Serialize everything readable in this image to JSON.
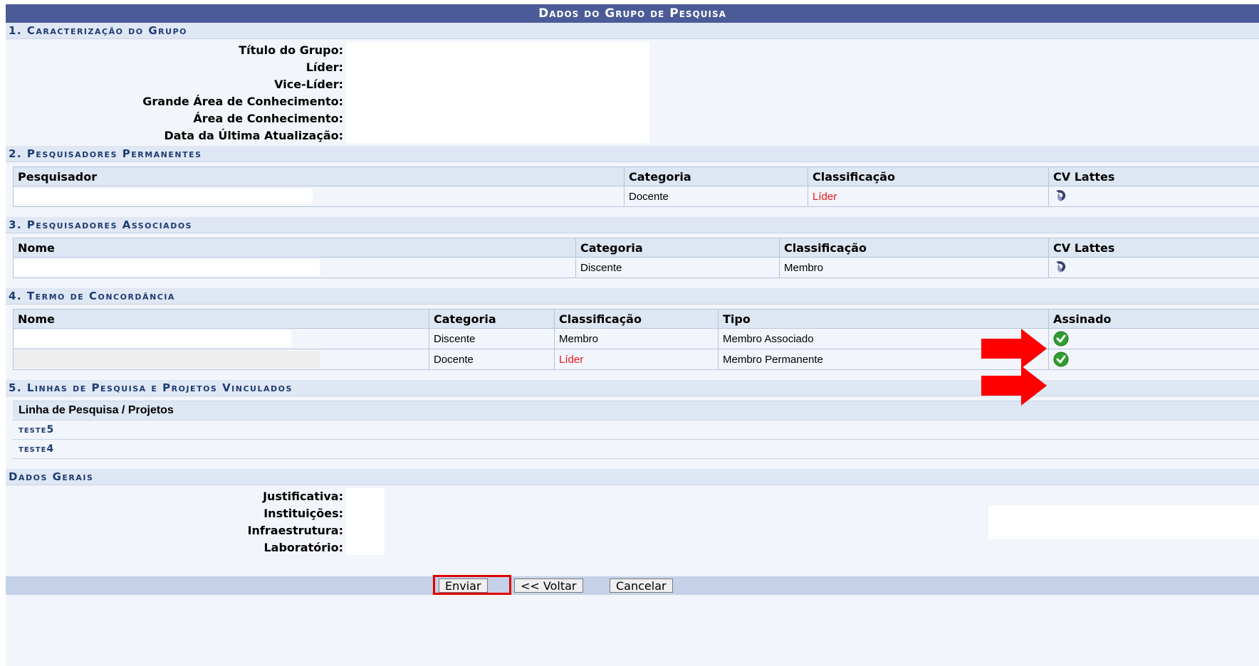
{
  "page_title": "Dados do Grupo de Pesquisa",
  "section1": {
    "title": "1. Caracterização do Grupo",
    "labels": [
      "Título do Grupo:",
      "Líder:",
      "Vice-Líder:",
      "Grande Área de Conhecimento:",
      "Área de Conhecimento:",
      "Data da Última Atualização:"
    ]
  },
  "section2": {
    "title": "2. Pesquisadores Permanentes",
    "headers": [
      "Pesquisador",
      "Categoria",
      "Classificação",
      "CV Lattes"
    ],
    "rows": [
      {
        "categoria": "Docente",
        "classificacao": "Líder"
      }
    ]
  },
  "section3": {
    "title": "3. Pesquisadores Associados",
    "headers": [
      "Nome",
      "Categoria",
      "Classificação",
      "CV Lattes"
    ],
    "rows": [
      {
        "categoria": "Discente",
        "classificacao": "Membro"
      }
    ]
  },
  "section4": {
    "title": "4. Termo de Concordância",
    "headers": [
      "Nome",
      "Categoria",
      "Classificação",
      "Tipo",
      "Assinado"
    ],
    "rows": [
      {
        "categoria": "Discente",
        "classificacao": "Membro",
        "tipo": "Membro Associado"
      },
      {
        "categoria": "Docente",
        "classificacao": "Líder",
        "tipo": "Membro Permanente"
      }
    ]
  },
  "section5": {
    "title": "5. Linhas de Pesquisa e Projetos Vinculados",
    "header": "Linha de Pesquisa / Projetos",
    "items": [
      "teste5",
      "teste4"
    ]
  },
  "dados_gerais": {
    "title": "Dados Gerais",
    "labels": [
      "Justificativa:",
      "Instituições:",
      "Infraestrutura:",
      "Laboratório:"
    ]
  },
  "buttons": {
    "enviar": "Enviar",
    "voltar": "<< Voltar",
    "cancelar": "Cancelar"
  },
  "colors": {
    "title_bar": "#4a5b98",
    "section_text": "#1f3b73",
    "lider_text": "#e8151b",
    "highlight_arrow": "#ff0000",
    "enviar_outline": "#e00000",
    "check_green": "#2e9e2e"
  },
  "icons": [
    "cv-lattes-icon",
    "signed-check-icon",
    "red-arrow-icon"
  ]
}
